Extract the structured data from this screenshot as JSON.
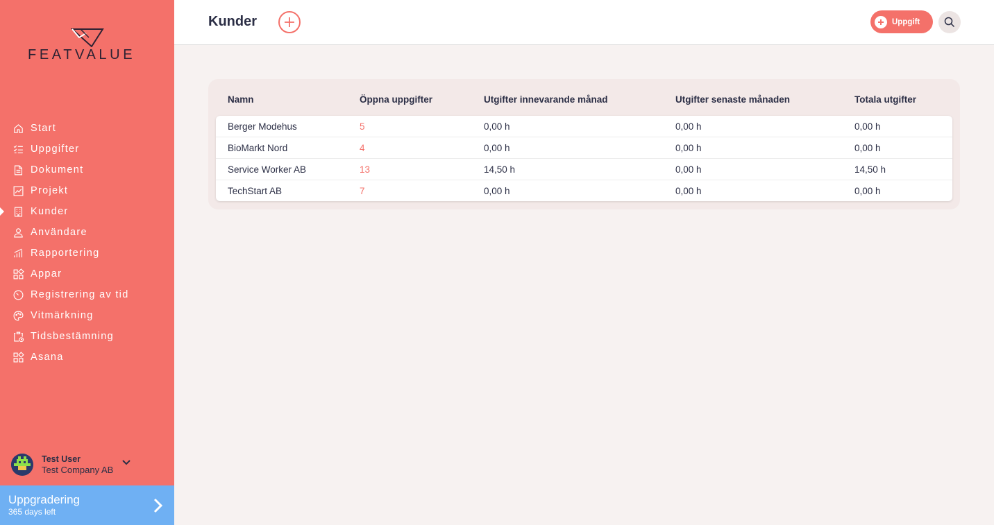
{
  "brand": {
    "logo_text": "FEATVALUE"
  },
  "nav": [
    {
      "label": "Start",
      "icon": "home-icon"
    },
    {
      "label": "Uppgifter",
      "icon": "checklist-icon"
    },
    {
      "label": "Dokument",
      "icon": "document-icon"
    },
    {
      "label": "Projekt",
      "icon": "chart-icon"
    },
    {
      "label": "Kunder",
      "icon": "building-icon",
      "active": true
    },
    {
      "label": "Användare",
      "icon": "user-icon"
    },
    {
      "label": "Rapportering",
      "icon": "bars-icon"
    },
    {
      "label": "Appar",
      "icon": "apps-icon"
    },
    {
      "label": "Registrering av tid",
      "icon": "timer-icon"
    },
    {
      "label": "Vitmärkning",
      "icon": "palette-icon"
    },
    {
      "label": "Tidsbestämning",
      "icon": "clipboard-clock-icon"
    },
    {
      "label": "Asana",
      "icon": "apps-icon"
    }
  ],
  "user": {
    "name": "Test User",
    "company": "Test Company AB"
  },
  "upgrade": {
    "title": "Uppgradering",
    "subtitle": "365 days left"
  },
  "header": {
    "title": "Kunder",
    "task_button": "Uppgift"
  },
  "table": {
    "columns": [
      "Namn",
      "Öppna uppgifter",
      "Utgifter innevarande månad",
      "Utgifter senaste månaden",
      "Totala utgifter"
    ],
    "rows": [
      [
        "Berger Modehus",
        "5",
        "0,00 h",
        "0,00 h",
        "0,00 h"
      ],
      [
        "BioMarkt Nord",
        "4",
        "0,00 h",
        "0,00 h",
        "0,00 h"
      ],
      [
        "Service Worker AB",
        "13",
        "14,50 h",
        "0,00 h",
        "14,50 h"
      ],
      [
        "TechStart AB",
        "7",
        "0,00 h",
        "0,00 h",
        "0,00 h"
      ]
    ]
  },
  "colors": {
    "accent": "#f4716a",
    "upgrade": "#6fb0f3",
    "text": "#2b2e45"
  }
}
